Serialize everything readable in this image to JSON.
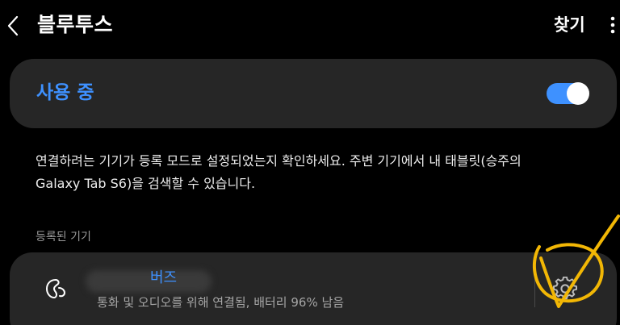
{
  "header": {
    "back_icon": "chevron-left-icon",
    "title": "블루투스",
    "search_label": "찾기",
    "more_icon": "more-vertical-icon"
  },
  "bluetooth_toggle": {
    "label": "사용 중",
    "state": "on",
    "accent_color": "#3e91ff"
  },
  "description": {
    "line1": "연결하려는 기기가 등록 모드로 설정되었는지 확인하세요. 주변 기기에서 내 태블릿(승주의",
    "line2": "Galaxy Tab S6)을 검색할 수 있습니다."
  },
  "paired_section": {
    "header": "등록된 기기",
    "devices": [
      {
        "icon": "earbuds-icon",
        "name": "버즈",
        "status": "통화 및 오디오를 위해 연결됨, 배터리 96% 남음",
        "settings_icon": "gear-icon"
      }
    ]
  },
  "annotation": {
    "shape": "circle-and-checkmark",
    "color": "#f2b705"
  }
}
